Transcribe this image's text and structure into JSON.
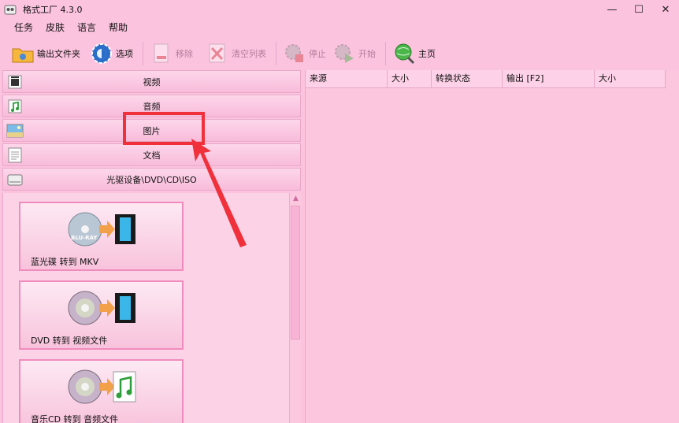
{
  "window": {
    "title": "格式工厂 4.3.0",
    "controls": {
      "minimize": "—",
      "maximize": "☐",
      "close": "✕"
    }
  },
  "menu": [
    "任务",
    "皮肤",
    "语言",
    "帮助"
  ],
  "toolbar": {
    "output_folder": "输出文件夹",
    "options": "选项",
    "remove": "移除",
    "clear_list": "清空列表",
    "stop": "停止",
    "start": "开始",
    "home": "主页"
  },
  "categories": [
    "视频",
    "音频",
    "图片",
    "文档",
    "光驱设备\\DVD\\CD\\ISO"
  ],
  "conversions": [
    "蓝光碟 转到 MKV",
    "DVD 转到 视频文件",
    "音乐CD 转到 音频文件"
  ],
  "art_text": {
    "bluray": "BLU-RAY"
  },
  "file_table": {
    "headers": [
      "来源",
      "大小",
      "转换状态",
      "输出 [F2]",
      "大小"
    ]
  },
  "colors": {
    "background": "#fcc3df",
    "annotation_red": "#f0303a",
    "item_border": "#f08cbd"
  },
  "annotation": {
    "highlighted_item": "图片"
  }
}
